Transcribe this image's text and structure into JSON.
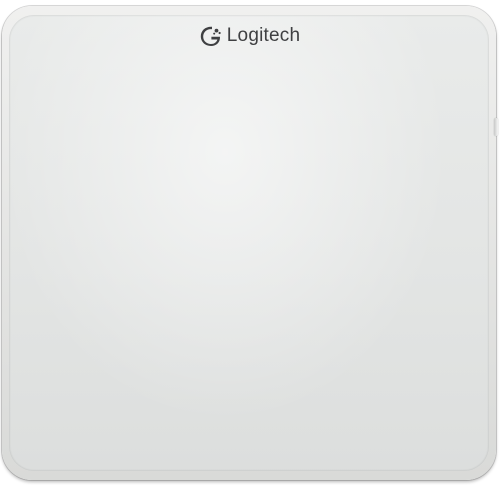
{
  "device": {
    "brand_name": "Logitech",
    "logo_icon": "logitech-g-eye-icon",
    "colors": {
      "surface": "#e6e8e7",
      "rim": "#d9dad8",
      "logo_text": "#3f4042"
    }
  }
}
